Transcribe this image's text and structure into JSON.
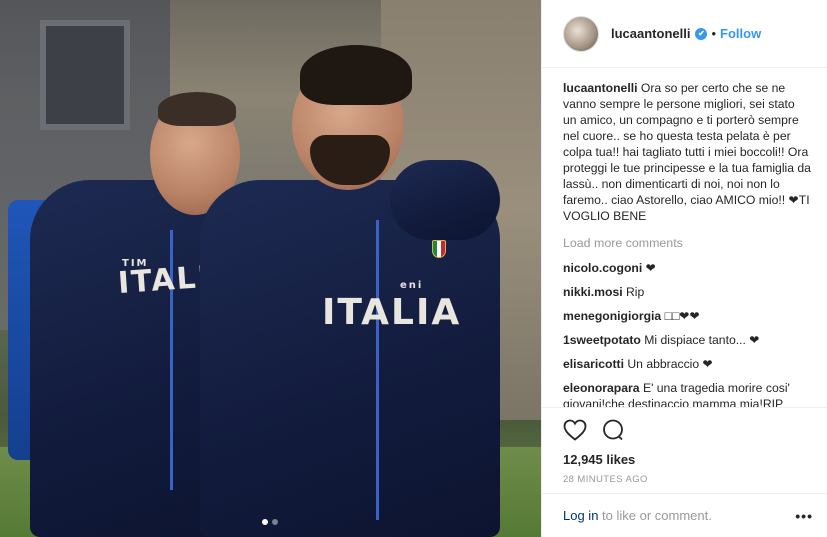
{
  "header": {
    "username": "lucaantonelli",
    "verified_glyph": "✔",
    "separator": "•",
    "follow_label": "Follow"
  },
  "photo": {
    "chest_text_left": "ITALIA",
    "chest_text_right": "ITALIA",
    "sponsor_left": "TIM",
    "sponsor_right": "eni",
    "carousel_dots": 2,
    "active_dot": 0
  },
  "caption": {
    "username": "lucaantonelli",
    "text": "Ora so per certo che se ne vanno sempre le persone migliori, sei stato un amico, un compagno e ti porterò sempre nel cuore.. se ho questa testa pelata è per colpa tua!! hai tagliato tutti i miei boccoli!! Ora proteggi le tue principesse e la tua famiglia da lassù.. non dimenticarti di noi, noi non lo faremo.. ciao Astorello, ciao AMICO mio!! ❤TI VOGLIO BENE"
  },
  "load_more_label": "Load more comments",
  "comments": [
    {
      "user": "nicolo.cogoni",
      "text": "❤"
    },
    {
      "user": "nikki.mosi",
      "text": "Rip"
    },
    {
      "user": "menegonigiorgia",
      "text": "□□❤❤"
    },
    {
      "user": "1sweetpotato",
      "text": "Mi dispiace tanto... ❤"
    },
    {
      "user": "elisaricotti",
      "text": "Un abbraccio ❤"
    },
    {
      "user": "eleonorapara",
      "text": "E' una tragedia morire cosi' giovani!che destinaccio mamma mia!RIP"
    }
  ],
  "likes": "12,945 likes",
  "timestamp": "28 MINUTES AGO",
  "login": {
    "link": "Log in",
    "rest": " to like or comment."
  },
  "more_glyph": "•••",
  "colors": {
    "accent": "#3897f0",
    "muted": "#999999",
    "text": "#262626",
    "link": "#003569"
  }
}
